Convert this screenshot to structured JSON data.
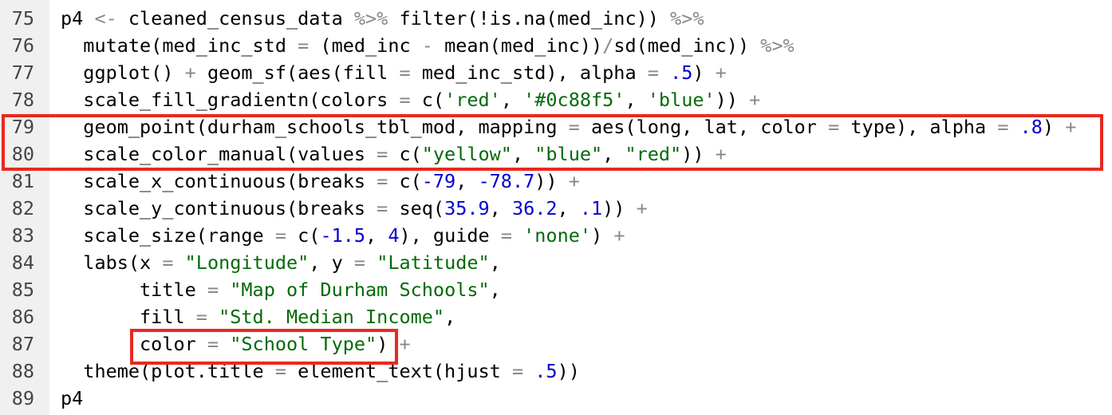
{
  "editor": {
    "highlight_color": "#e8291f",
    "colors": {
      "gutter_bg": "#f0f0f0",
      "operator": "#888888",
      "string": "#036a07",
      "number": "#0000cd",
      "plain": "#000000"
    },
    "lines": [
      {
        "number": "75",
        "tokens": [
          {
            "t": "p4 ",
            "k": "plain"
          },
          {
            "t": "<-",
            "k": "op"
          },
          {
            "t": " cleaned_census_data ",
            "k": "plain"
          },
          {
            "t": "%>%",
            "k": "op"
          },
          {
            "t": " filter(!is.na(med_inc)) ",
            "k": "plain"
          },
          {
            "t": "%>%",
            "k": "op"
          }
        ]
      },
      {
        "number": "76",
        "tokens": [
          {
            "t": "  mutate(med_inc_std ",
            "k": "plain"
          },
          {
            "t": "=",
            "k": "op"
          },
          {
            "t": " (med_inc ",
            "k": "plain"
          },
          {
            "t": "-",
            "k": "op"
          },
          {
            "t": " mean(med_inc))",
            "k": "plain"
          },
          {
            "t": "/",
            "k": "op"
          },
          {
            "t": "sd(med_inc)) ",
            "k": "plain"
          },
          {
            "t": "%>%",
            "k": "op"
          }
        ]
      },
      {
        "number": "77",
        "tokens": [
          {
            "t": "  ggplot() ",
            "k": "plain"
          },
          {
            "t": "+",
            "k": "op"
          },
          {
            "t": " geom_sf(aes(fill ",
            "k": "plain"
          },
          {
            "t": "=",
            "k": "op"
          },
          {
            "t": " med_inc_std), alpha ",
            "k": "plain"
          },
          {
            "t": "=",
            "k": "op"
          },
          {
            "t": " ",
            "k": "plain"
          },
          {
            "t": ".5",
            "k": "num"
          },
          {
            "t": ") ",
            "k": "plain"
          },
          {
            "t": "+",
            "k": "op"
          }
        ]
      },
      {
        "number": "78",
        "tokens": [
          {
            "t": "  scale_fill_gradientn(colors ",
            "k": "plain"
          },
          {
            "t": "=",
            "k": "op"
          },
          {
            "t": " c(",
            "k": "plain"
          },
          {
            "t": "'red'",
            "k": "str"
          },
          {
            "t": ", ",
            "k": "plain"
          },
          {
            "t": "'#0c88f5'",
            "k": "str"
          },
          {
            "t": ", ",
            "k": "plain"
          },
          {
            "t": "'blue'",
            "k": "str"
          },
          {
            "t": ")) ",
            "k": "plain"
          },
          {
            "t": "+",
            "k": "op"
          }
        ]
      },
      {
        "number": "79",
        "tokens": [
          {
            "t": "  geom_point(durham_schools_tbl_mod, mapping ",
            "k": "plain"
          },
          {
            "t": "=",
            "k": "op"
          },
          {
            "t": " aes(long, lat, color ",
            "k": "plain"
          },
          {
            "t": "=",
            "k": "op"
          },
          {
            "t": " type), alpha ",
            "k": "plain"
          },
          {
            "t": "=",
            "k": "op"
          },
          {
            "t": " ",
            "k": "plain"
          },
          {
            "t": ".8",
            "k": "num"
          },
          {
            "t": ") ",
            "k": "plain"
          },
          {
            "t": "+",
            "k": "op"
          }
        ]
      },
      {
        "number": "80",
        "tokens": [
          {
            "t": "  scale_color_manual(values ",
            "k": "plain"
          },
          {
            "t": "=",
            "k": "op"
          },
          {
            "t": " c(",
            "k": "plain"
          },
          {
            "t": "\"yellow\"",
            "k": "str"
          },
          {
            "t": ", ",
            "k": "plain"
          },
          {
            "t": "\"blue\"",
            "k": "str"
          },
          {
            "t": ", ",
            "k": "plain"
          },
          {
            "t": "\"red\"",
            "k": "str"
          },
          {
            "t": ")) ",
            "k": "plain"
          },
          {
            "t": "+",
            "k": "op"
          }
        ]
      },
      {
        "number": "81",
        "tokens": [
          {
            "t": "  scale_x_continuous(breaks ",
            "k": "plain"
          },
          {
            "t": "=",
            "k": "op"
          },
          {
            "t": " c(",
            "k": "plain"
          },
          {
            "t": "-79",
            "k": "num"
          },
          {
            "t": ", ",
            "k": "plain"
          },
          {
            "t": "-78.7",
            "k": "num"
          },
          {
            "t": ")) ",
            "k": "plain"
          },
          {
            "t": "+",
            "k": "op"
          }
        ]
      },
      {
        "number": "82",
        "tokens": [
          {
            "t": "  scale_y_continuous(breaks ",
            "k": "plain"
          },
          {
            "t": "=",
            "k": "op"
          },
          {
            "t": " seq(",
            "k": "plain"
          },
          {
            "t": "35.9",
            "k": "num"
          },
          {
            "t": ", ",
            "k": "plain"
          },
          {
            "t": "36.2",
            "k": "num"
          },
          {
            "t": ", ",
            "k": "plain"
          },
          {
            "t": ".1",
            "k": "num"
          },
          {
            "t": ")) ",
            "k": "plain"
          },
          {
            "t": "+",
            "k": "op"
          }
        ]
      },
      {
        "number": "83",
        "tokens": [
          {
            "t": "  scale_size(range ",
            "k": "plain"
          },
          {
            "t": "=",
            "k": "op"
          },
          {
            "t": " c(",
            "k": "plain"
          },
          {
            "t": "-1.5",
            "k": "num"
          },
          {
            "t": ", ",
            "k": "plain"
          },
          {
            "t": "4",
            "k": "num"
          },
          {
            "t": "), guide ",
            "k": "plain"
          },
          {
            "t": "=",
            "k": "op"
          },
          {
            "t": " ",
            "k": "plain"
          },
          {
            "t": "'none'",
            "k": "str"
          },
          {
            "t": ") ",
            "k": "plain"
          },
          {
            "t": "+",
            "k": "op"
          }
        ]
      },
      {
        "number": "84",
        "tokens": [
          {
            "t": "  labs(x ",
            "k": "plain"
          },
          {
            "t": "=",
            "k": "op"
          },
          {
            "t": " ",
            "k": "plain"
          },
          {
            "t": "\"Longitude\"",
            "k": "str"
          },
          {
            "t": ", y ",
            "k": "plain"
          },
          {
            "t": "=",
            "k": "op"
          },
          {
            "t": " ",
            "k": "plain"
          },
          {
            "t": "\"Latitude\"",
            "k": "str"
          },
          {
            "t": ",",
            "k": "plain"
          }
        ]
      },
      {
        "number": "85",
        "tokens": [
          {
            "t": "       title ",
            "k": "plain"
          },
          {
            "t": "=",
            "k": "op"
          },
          {
            "t": " ",
            "k": "plain"
          },
          {
            "t": "\"Map of Durham Schools\"",
            "k": "str"
          },
          {
            "t": ",",
            "k": "plain"
          }
        ]
      },
      {
        "number": "86",
        "tokens": [
          {
            "t": "       fill ",
            "k": "plain"
          },
          {
            "t": "=",
            "k": "op"
          },
          {
            "t": " ",
            "k": "plain"
          },
          {
            "t": "\"Std. Median Income\"",
            "k": "str"
          },
          {
            "t": ",",
            "k": "plain"
          }
        ]
      },
      {
        "number": "87",
        "tokens": [
          {
            "t": "       color ",
            "k": "plain"
          },
          {
            "t": "=",
            "k": "op"
          },
          {
            "t": " ",
            "k": "plain"
          },
          {
            "t": "\"School Type\"",
            "k": "str"
          },
          {
            "t": ") ",
            "k": "plain"
          },
          {
            "t": "+",
            "k": "op"
          }
        ]
      },
      {
        "number": "88",
        "tokens": [
          {
            "t": "  theme(plot.title ",
            "k": "plain"
          },
          {
            "t": "=",
            "k": "op"
          },
          {
            "t": " element_text(hjust ",
            "k": "plain"
          },
          {
            "t": "=",
            "k": "op"
          },
          {
            "t": " ",
            "k": "plain"
          },
          {
            "t": ".5",
            "k": "num"
          },
          {
            "t": "))",
            "k": "plain"
          }
        ]
      },
      {
        "number": "89",
        "tokens": [
          {
            "t": "p4",
            "k": "plain"
          }
        ]
      }
    ]
  }
}
